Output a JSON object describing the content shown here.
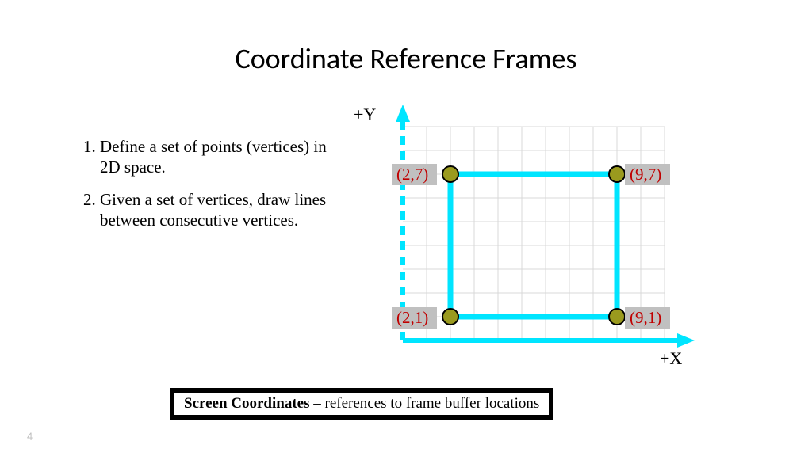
{
  "title": "Coordinate Reference Frames",
  "bullets": {
    "item1": "Define a set of points (vertices) in 2D space.",
    "item2": "Given a set of vertices, draw lines between consecutive vertices."
  },
  "axes": {
    "y": "+Y",
    "x": "+X"
  },
  "vertices": {
    "tl": "(2,7)",
    "tr": "(9,7)",
    "bl": "(2,1)",
    "br": "(9,1)"
  },
  "footer": {
    "bold": "Screen Coordinates",
    "rest": " – references to frame buffer locations"
  },
  "page_number": "4",
  "colors": {
    "axis": "#00e5ff",
    "vertex_fill": "#9a9a1e",
    "vertex_stroke": "#000",
    "label_bg": "#c0c0c0",
    "label_text": "#c00000",
    "grid": "#d9d9d9"
  },
  "chart_data": {
    "type": "scatter",
    "title": "Coordinate Reference Frames",
    "xlabel": "+X",
    "ylabel": "+Y",
    "xlim": [
      0,
      11
    ],
    "ylim": [
      0,
      9
    ],
    "points": [
      {
        "x": 2,
        "y": 7,
        "label": "(2,7)"
      },
      {
        "x": 9,
        "y": 7,
        "label": "(9,7)"
      },
      {
        "x": 9,
        "y": 1,
        "label": "(9,1)"
      },
      {
        "x": 2,
        "y": 1,
        "label": "(2,1)"
      }
    ],
    "polyline_closed": true
  }
}
